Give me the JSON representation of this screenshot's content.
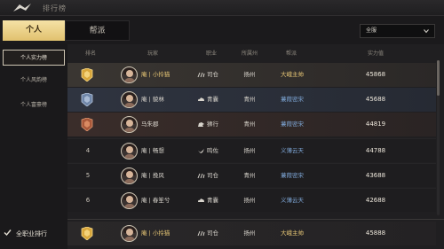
{
  "header": {
    "title": "排行榜"
  },
  "tabs": {
    "personal": "个人",
    "guild": "帮派"
  },
  "scope": {
    "selected": "全服"
  },
  "sidebar": {
    "items": [
      {
        "label": "个人实力榜"
      },
      {
        "label": "个人风韵榜"
      },
      {
        "label": "个人富豪榜"
      }
    ]
  },
  "table": {
    "columns": [
      "排名",
      "玩家",
      "职业",
      "所属州",
      "帮派",
      "实力值"
    ],
    "rows": [
      {
        "rank": "1",
        "name": "庵 | 小拎猫",
        "class": "司仓",
        "class_icon": "claw-icon",
        "state": "扬州",
        "guild": "大峨主帅",
        "guild_color": "gold",
        "score": "45868",
        "name_color": "gold"
      },
      {
        "rank": "2",
        "name": "庵 | 貌林",
        "class": "青囊",
        "class_icon": "cloud-icon",
        "state": "青州",
        "guild": "蒹葭密宋",
        "guild_color": "blue",
        "score": "45688",
        "name_color": "white"
      },
      {
        "rank": "3",
        "name": "马朱郡",
        "class": "狮行",
        "class_icon": "lion-icon",
        "state": "青州",
        "guild": "蒹葭密宋",
        "guild_color": "blue",
        "score": "44819",
        "name_color": "white"
      },
      {
        "rank": "4",
        "name": "庵 | 畅想",
        "class": "鸣佐",
        "class_icon": "bird-icon",
        "state": "扬州",
        "guild": "义薄云天",
        "guild_color": "blue",
        "score": "44788",
        "name_color": "white"
      },
      {
        "rank": "5",
        "name": "庵 | 挽风",
        "class": "司仓",
        "class_icon": "claw-icon",
        "state": "青州",
        "guild": "蒹葭密宋",
        "guild_color": "blue",
        "score": "43688",
        "name_color": "white"
      },
      {
        "rank": "6",
        "name": "庵 | 春笙兮",
        "class": "青囊",
        "class_icon": "cloud-icon",
        "state": "扬州",
        "guild": "义薄云天",
        "guild_color": "blue",
        "score": "42688",
        "name_color": "white"
      }
    ],
    "my_row": {
      "rank": "1",
      "name": "庵 | 小拎猫",
      "class": "司仓",
      "class_icon": "claw-icon",
      "state": "扬州",
      "guild": "大峨主帅",
      "guild_color": "gold",
      "score": "45888",
      "name_color": "gold"
    }
  },
  "footer": {
    "checkbox_label": "全职业排行",
    "checked": true
  },
  "colors": {
    "accent_gold": "#e1c16e",
    "guild_blue": "#7fa8d8",
    "name_gold": "#e8c776"
  }
}
